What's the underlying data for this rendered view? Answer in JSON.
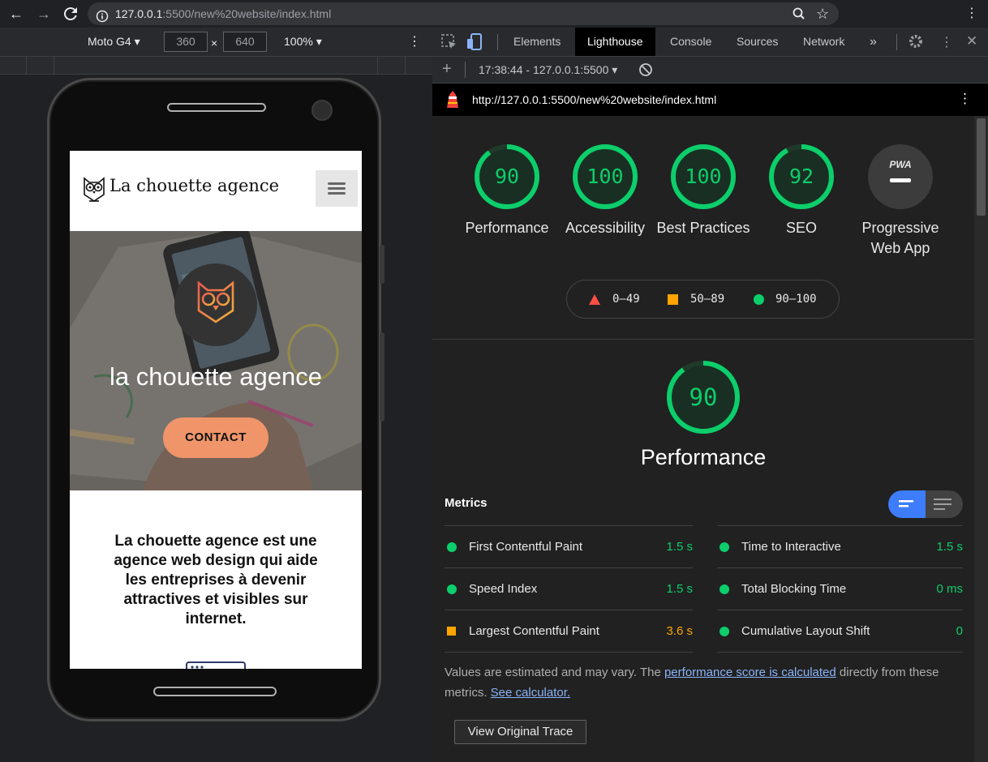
{
  "browser": {
    "url_host": "127.0.0.1",
    "url_rest": ":5500/new%20website/index.html"
  },
  "device_toolbar": {
    "device": "Moto G4",
    "width": "360",
    "x_sep": "×",
    "height": "640",
    "zoom": "100%"
  },
  "site": {
    "logo_text": "La chouette agence",
    "hero_title": "la chouette agence",
    "contact_label": "CONTACT",
    "intro": "La chouette agence est une agence web design qui aide les entreprises à devenir attractives et visibles sur internet."
  },
  "devtools": {
    "tabs": [
      "Elements",
      "Lighthouse",
      "Console",
      "Sources",
      "Network"
    ],
    "active_tab": "Lighthouse",
    "more_tabs": "»",
    "report_select": "17:38:44 - 127.0.0.1:5500",
    "report_url": "http://127.0.0.1:5500/new%20website/index.html"
  },
  "lighthouse": {
    "categories": [
      {
        "score": "90",
        "label": "Performance",
        "value": 0.9
      },
      {
        "score": "100",
        "label": "Accessibility",
        "value": 1.0
      },
      {
        "score": "100",
        "label": "Best Practices",
        "value": 1.0
      },
      {
        "score": "92",
        "label": "SEO",
        "value": 0.92
      },
      {
        "score": "PWA",
        "label": "Progressive Web App"
      }
    ],
    "legend": {
      "fail": "0–49",
      "average": "50–89",
      "pass": "90–100"
    },
    "perf_score": "90",
    "perf_value": 0.9,
    "perf_title": "Performance",
    "metrics_title": "Metrics",
    "metrics": [
      {
        "label": "First Contentful Paint",
        "value": "1.5 s",
        "status": "pass"
      },
      {
        "label": "Time to Interactive",
        "value": "1.5 s",
        "status": "pass"
      },
      {
        "label": "Speed Index",
        "value": "1.5 s",
        "status": "pass"
      },
      {
        "label": "Total Blocking Time",
        "value": "0 ms",
        "status": "pass"
      },
      {
        "label": "Largest Contentful Paint",
        "value": "3.6 s",
        "status": "average"
      },
      {
        "label": "Cumulative Layout Shift",
        "value": "0",
        "status": "pass"
      }
    ],
    "note_pre": "Values are estimated and may vary. The ",
    "note_link1": "performance score is calculated",
    "note_mid": " directly from these metrics. ",
    "note_link2": "See calculator.",
    "trace_button": "View Original Trace"
  },
  "colors": {
    "pass": "#0cce6b",
    "average": "#ffa400",
    "fail": "#ff4e42",
    "accent": "#3d7dfb",
    "cta": "#f0956a"
  }
}
